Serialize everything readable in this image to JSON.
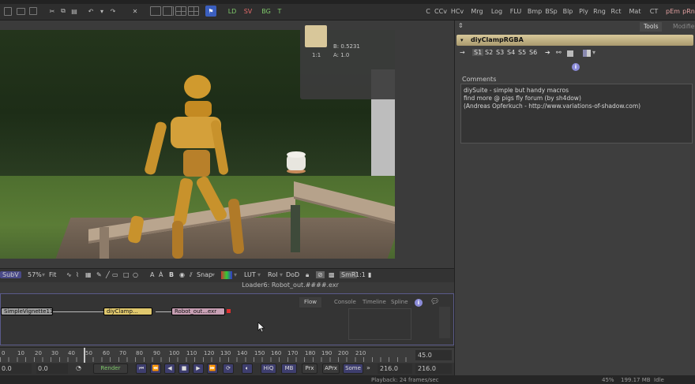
{
  "toolbar": {
    "left_tools": [
      "LD",
      "SV",
      "BG",
      "T"
    ],
    "right_tools": [
      "C",
      "CCv",
      "HCv",
      "Mrg",
      "Log",
      "FLU",
      "Bmp",
      "BSp",
      "Blp",
      "Ply",
      "Rng",
      "Rct",
      "Mat",
      "CT",
      "pEm",
      "pRn"
    ]
  },
  "viewer": {
    "info": {
      "b_value": "B: 0.5231",
      "a_value": "A: 1.0",
      "zoom_ratio": "1:1"
    },
    "bar": {
      "subv": "SubV",
      "zoom": "57%",
      "fit": "Fit",
      "snap": "Snap",
      "lut": "LUT",
      "roi": "RoI",
      "dod": "DoD",
      "smr": "SmR",
      "ratio": "1:1"
    },
    "status": "Loader6: Robot_out.####.exr"
  },
  "flow": {
    "tabs": [
      "Flow",
      "Console",
      "Timeline",
      "Spline"
    ],
    "nodes": [
      "SimpleVignette11",
      "diyClamp...",
      "Robot_out...exr"
    ]
  },
  "timeline": {
    "ticks": [
      "0",
      "10",
      "20",
      "30",
      "40",
      "50",
      "60",
      "70",
      "80",
      "90",
      "100",
      "110",
      "120",
      "130",
      "140",
      "150",
      "160",
      "170",
      "180",
      "190",
      "200",
      "210"
    ],
    "current": "45.0"
  },
  "transport": {
    "start": "0.0",
    "in": "0.0",
    "render": "Render",
    "hiq": "HiQ",
    "mb": "MB",
    "prx": "Prx",
    "aprx": "APrx",
    "some": "Some",
    "out": "216.0",
    "end": "216.0"
  },
  "statusbar": {
    "playback": "Playback: 24 frames/sec",
    "zoom_pct": "45%",
    "memory": "199.17 MB",
    "idle": "Idle"
  },
  "inspector": {
    "tabs": [
      "Tools",
      "Modifiers"
    ],
    "node_title": "diyClampRGBA",
    "sub_tabs": [
      "S1",
      "S2",
      "S3",
      "S4",
      "S5",
      "S6"
    ],
    "comments_label": "Comments",
    "comments": [
      "diySuite - simple but handy macros",
      "find more @ pigs fly forum (by sh4dow)",
      "(Andreas Opferkuch - http://www.variations-of-shadow.com)"
    ]
  }
}
